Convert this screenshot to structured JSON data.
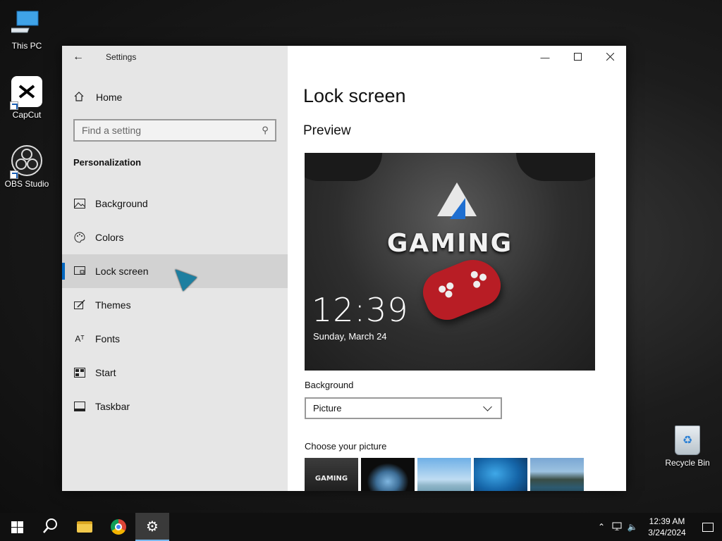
{
  "desktop": {
    "icons": [
      {
        "label": "This PC"
      },
      {
        "label": "CapCut"
      },
      {
        "label": "OBS Studio"
      },
      {
        "label": "Recycle Bin"
      }
    ]
  },
  "window": {
    "title": "Settings",
    "sidebar": {
      "home_label": "Home",
      "search_placeholder": "Find a setting",
      "section": "Personalization",
      "items": [
        {
          "label": "Background",
          "icon": "image-icon"
        },
        {
          "label": "Colors",
          "icon": "palette-icon"
        },
        {
          "label": "Lock screen",
          "icon": "lock-screen-icon",
          "selected": true
        },
        {
          "label": "Themes",
          "icon": "brush-icon"
        },
        {
          "label": "Fonts",
          "icon": "font-icon"
        },
        {
          "label": "Start",
          "icon": "start-icon"
        },
        {
          "label": "Taskbar",
          "icon": "taskbar-icon"
        }
      ]
    },
    "content": {
      "page_title": "Lock screen",
      "preview_heading": "Preview",
      "preview": {
        "brand_text": "GAMING",
        "time": "12:39",
        "date": "Sunday, March 24"
      },
      "background_label": "Background",
      "background_value": "Picture",
      "choose_label": "Choose your picture",
      "thumb1_text": "GAMING"
    }
  },
  "taskbar": {
    "clock_time": "12:39 AM",
    "clock_date": "3/24/2024"
  },
  "colors": {
    "accent": "#0067c0",
    "sidebar_bg": "#e6e6e6",
    "selected_bg": "#d2d2d2",
    "taskbar_bg": "#101010"
  }
}
